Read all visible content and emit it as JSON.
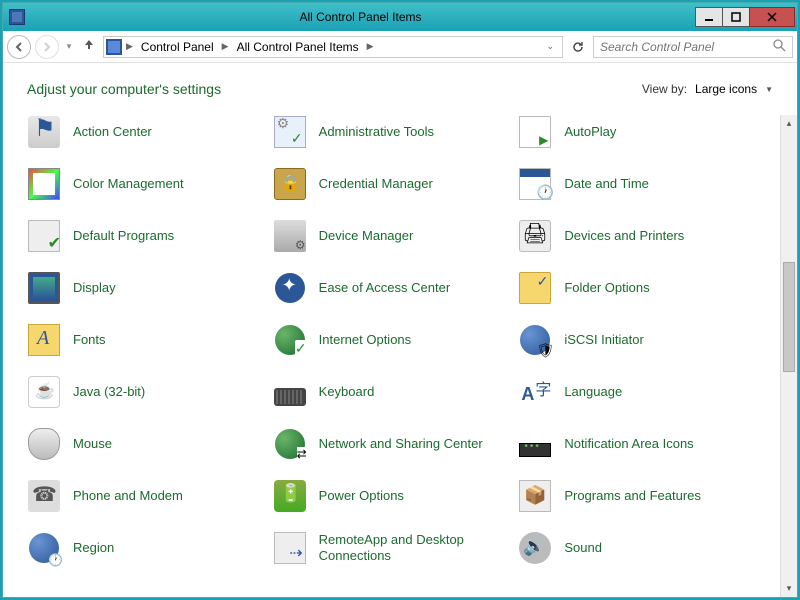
{
  "window": {
    "title": "All Control Panel Items"
  },
  "breadcrumb": {
    "root": "Control Panel",
    "current": "All Control Panel Items"
  },
  "search": {
    "placeholder": "Search Control Panel"
  },
  "header": {
    "title": "Adjust your computer's settings"
  },
  "viewby": {
    "label": "View by:",
    "value": "Large icons"
  },
  "items": [
    {
      "label": "Action Center",
      "icon": "flag"
    },
    {
      "label": "Administrative Tools",
      "icon": "admin"
    },
    {
      "label": "AutoPlay",
      "icon": "autoplay"
    },
    {
      "label": "Color Management",
      "icon": "color"
    },
    {
      "label": "Credential Manager",
      "icon": "cred"
    },
    {
      "label": "Date and Time",
      "icon": "date"
    },
    {
      "label": "Default Programs",
      "icon": "defprog"
    },
    {
      "label": "Device Manager",
      "icon": "devmgr"
    },
    {
      "label": "Devices and Printers",
      "icon": "printer"
    },
    {
      "label": "Display",
      "icon": "display"
    },
    {
      "label": "Ease of Access Center",
      "icon": "ease"
    },
    {
      "label": "Folder Options",
      "icon": "folder"
    },
    {
      "label": "Fonts",
      "icon": "fonts"
    },
    {
      "label": "Internet Options",
      "icon": "inet"
    },
    {
      "label": "iSCSI Initiator",
      "icon": "iscsi"
    },
    {
      "label": "Java (32-bit)",
      "icon": "java"
    },
    {
      "label": "Keyboard",
      "icon": "kb"
    },
    {
      "label": "Language",
      "icon": "lang"
    },
    {
      "label": "Mouse",
      "icon": "mouse"
    },
    {
      "label": "Network and Sharing Center",
      "icon": "net"
    },
    {
      "label": "Notification Area Icons",
      "icon": "notif"
    },
    {
      "label": "Phone and Modem",
      "icon": "phone"
    },
    {
      "label": "Power Options",
      "icon": "power"
    },
    {
      "label": "Programs and Features",
      "icon": "programs"
    },
    {
      "label": "Region",
      "icon": "region"
    },
    {
      "label": "RemoteApp and Desktop Connections",
      "icon": "remote"
    },
    {
      "label": "Sound",
      "icon": "sound"
    }
  ]
}
